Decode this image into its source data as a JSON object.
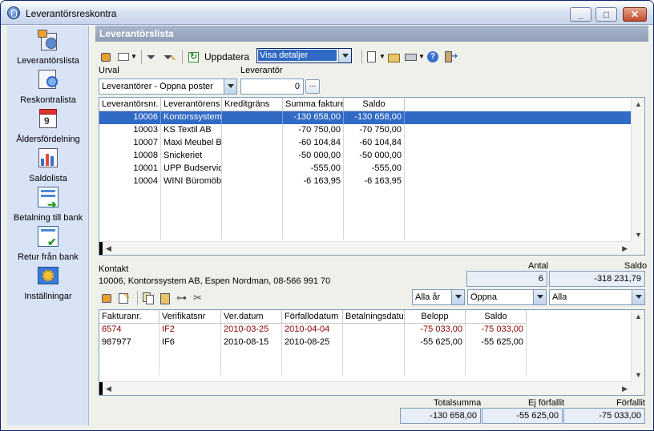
{
  "window": {
    "title": "Leverantörsreskontra"
  },
  "sidebar": {
    "items": [
      {
        "label": "Leverantörslista",
        "icon": "supplier-list-icon"
      },
      {
        "label": "Reskontralista",
        "icon": "ledger-list-icon"
      },
      {
        "label": "Åldersfördelning",
        "icon": "calendar-icon"
      },
      {
        "label": "Saldolista",
        "icon": "balance-chart-icon"
      },
      {
        "label": "Betalning till bank",
        "icon": "bank-payment-icon"
      },
      {
        "label": "Retur från bank",
        "icon": "bank-return-icon"
      },
      {
        "label": "Inställningar",
        "icon": "settings-icon"
      }
    ]
  },
  "panel": {
    "title": "Leverantörslista"
  },
  "toolbar": {
    "refresh_label": "Uppdatera",
    "view_select": "Visa detaljer"
  },
  "filter": {
    "urval_label": "Urval",
    "urval_value": "Leverantörer - Öppna poster",
    "supplier_label": "Leverantör",
    "supplier_value": "0",
    "browse_label": "..."
  },
  "suppliers": {
    "columns": [
      "Leverantörsnr.",
      "Leverantörens n",
      "Kreditgräns",
      "Summa fakturera",
      "Saldo"
    ],
    "rows": [
      {
        "nr": "10006",
        "name": "Kontorssystem A",
        "credit": "",
        "total": "-130 658,00",
        "balance": "-130 658,00"
      },
      {
        "nr": "10003",
        "name": "KS Textil AB",
        "credit": "",
        "total": "-70 750,00",
        "balance": "-70 750,00"
      },
      {
        "nr": "10007",
        "name": "Maxi Meubel BV",
        "credit": "",
        "total": "-60 104,84",
        "balance": "-60 104,84"
      },
      {
        "nr": "10008",
        "name": "Snickeriet",
        "credit": "",
        "total": "-50 000,00",
        "balance": "-50 000,00"
      },
      {
        "nr": "10001",
        "name": "UPP Budservic",
        "credit": "",
        "total": "-555,00",
        "balance": "-555,00"
      },
      {
        "nr": "10004",
        "name": "WINI Büromöbe",
        "credit": "",
        "total": "-6 163,95",
        "balance": "-6 163,95"
      }
    ]
  },
  "contact": {
    "label": "Kontakt",
    "text": "10006, Kontorssystem AB, Espen Nordman, 08-566 991 70",
    "count_label": "Antal",
    "count_value": "6",
    "saldo_label": "Saldo",
    "saldo_value": "-318 231,79"
  },
  "invoice_filters": {
    "year": "Alla år",
    "status": "Öppna",
    "type": "Alla"
  },
  "invoices": {
    "columns": [
      "Fakturanr.",
      "Verifikatsnr",
      "Ver.datum",
      "Förfallodatum",
      "Betalningsdatum",
      "Belopp",
      "Saldo"
    ],
    "rows": [
      {
        "nr": "6574",
        "ver": "IF2",
        "verdate": "2010-03-25",
        "due": "2010-04-04",
        "paid": "",
        "amount": "-75 033,00",
        "balance": "-75 033,00",
        "overdue": true
      },
      {
        "nr": "987977",
        "ver": "IF6",
        "verdate": "2010-08-15",
        "due": "2010-08-25",
        "paid": "",
        "amount": "-55 625,00",
        "balance": "-55 625,00",
        "overdue": false
      }
    ]
  },
  "totals": {
    "total_label": "Totalsumma",
    "total_value": "-130 658,00",
    "notdue_label": "Ej förfallit",
    "notdue_value": "-55 625,00",
    "overdue_label": "Förfallit",
    "overdue_value": "-75 033,00"
  }
}
